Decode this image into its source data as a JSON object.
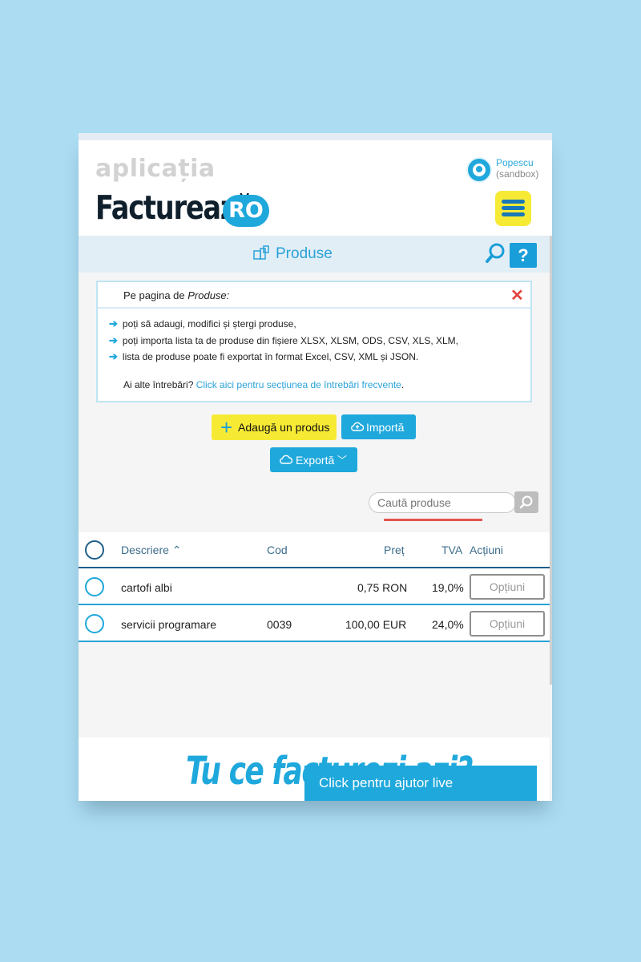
{
  "app": {
    "logo_small": "aplicația",
    "logo_big": "Facturează",
    "logo_ro": "RO",
    "user_name": "Popescu",
    "user_env": "(sandbox)"
  },
  "page": {
    "title": "Produse",
    "help": "?"
  },
  "info": {
    "title_prefix": "Pe pagina de ",
    "title_em": "Produse:",
    "close": "✕",
    "lines": [
      "poți să adaugi, modifici și ștergi produse,",
      "poți importa lista ta de produse din fișiere XLSX, XLSM, ODS, CSV, XLS, XLM,",
      "lista de produse poate fi exportat în format Excel, CSV, XML și JSON."
    ],
    "question": "Ai alte întrebări? ",
    "link": "Click aici pentru secțiunea de întrebări frecvente",
    "link_end": "."
  },
  "actions": {
    "add": "Adaugă un produs",
    "import": "Importă",
    "export": "Exportă"
  },
  "search": {
    "placeholder": "Caută produse"
  },
  "table": {
    "headers": {
      "description": "Descriere",
      "code": "Cod",
      "price": "Preț",
      "vat": "TVA",
      "actions": "Acțiuni"
    },
    "rows": [
      {
        "description": "cartofi albi",
        "code": "",
        "price": "0,75 RON",
        "vat": "19,0%",
        "action": "Opțiuni"
      },
      {
        "description": "servicii programare",
        "code": "0039",
        "price": "100,00 EUR",
        "vat": "24,0%",
        "action": "Opțiuni"
      }
    ]
  },
  "footer": {
    "tagline": "Tu ce facturezi azi?",
    "live_help": "Click pentru ajutor live"
  },
  "colors": {
    "accent": "#1fa8dc",
    "yellow": "#f7ea35",
    "danger": "#e3443f",
    "background": "#abdcf2"
  }
}
